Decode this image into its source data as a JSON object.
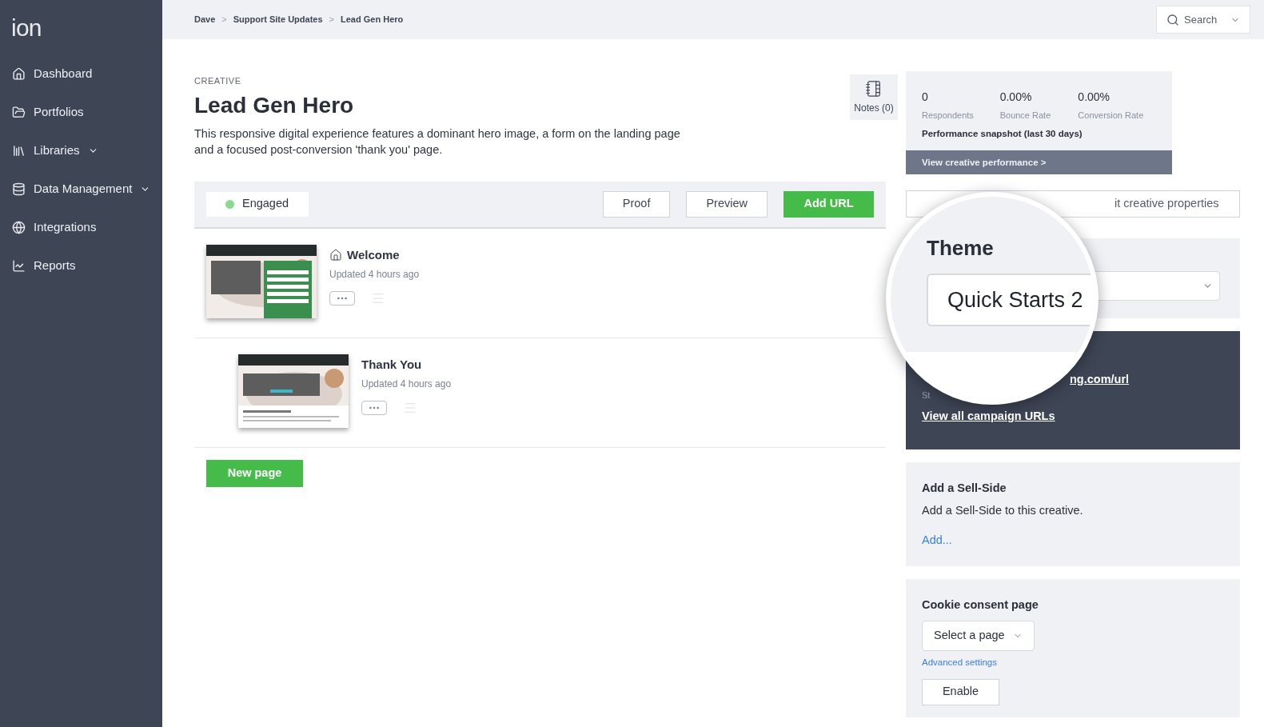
{
  "logo": "ion",
  "sidebar": {
    "items": [
      {
        "label": "Dashboard",
        "expandable": false
      },
      {
        "label": "Portfolios",
        "expandable": false
      },
      {
        "label": "Libraries",
        "expandable": true
      },
      {
        "label": "Data Management",
        "expandable": true
      },
      {
        "label": "Integrations",
        "expandable": false
      },
      {
        "label": "Reports",
        "expandable": false
      }
    ]
  },
  "breadcrumb": {
    "items": [
      "Dave",
      "Support Site Updates",
      "Lead Gen Hero"
    ],
    "separator": ">"
  },
  "search": {
    "label": "Search"
  },
  "creative": {
    "eyebrow": "CREATIVE",
    "title": "Lead Gen Hero",
    "description": "This responsive digital experience features a dominant hero image, a form on the landing page and a focused post-conversion 'thank you' page."
  },
  "notes": {
    "label": "Notes (0)"
  },
  "performance": {
    "stats": [
      {
        "value": "0",
        "label": "Respondents"
      },
      {
        "value": "0.00%",
        "label": "Bounce Rate"
      },
      {
        "value": "0.00%",
        "label": "Conversion Rate"
      }
    ],
    "caption": "Performance snapshot (last 30 days)",
    "link": "View creative performance >"
  },
  "toolbar": {
    "status": {
      "label": "Engaged",
      "color": "#8fd88f"
    },
    "buttons": [
      "Proof",
      "Preview"
    ],
    "primary": "Add URL"
  },
  "pages": [
    {
      "title": "Welcome",
      "updated": "Updated 4 hours ago",
      "home": true,
      "children": [
        {
          "title": "Thank You",
          "updated": "Updated 4 hours ago",
          "home": false
        }
      ]
    }
  ],
  "new_page": "New page",
  "edit_properties": "it creative properties",
  "theme": {
    "label": "Theme",
    "value": "Quick Starts 2"
  },
  "urls": {
    "url": "ng.com/url",
    "caption": "St",
    "view_all": "View all campaign URLs"
  },
  "sell_side": {
    "title": "Add a Sell-Side",
    "text": "Add a Sell-Side to this creative.",
    "link": "Add..."
  },
  "cookie": {
    "title": "Cookie consent page",
    "select": "Select a page",
    "advanced": "Advanced settings",
    "button": "Enable"
  }
}
